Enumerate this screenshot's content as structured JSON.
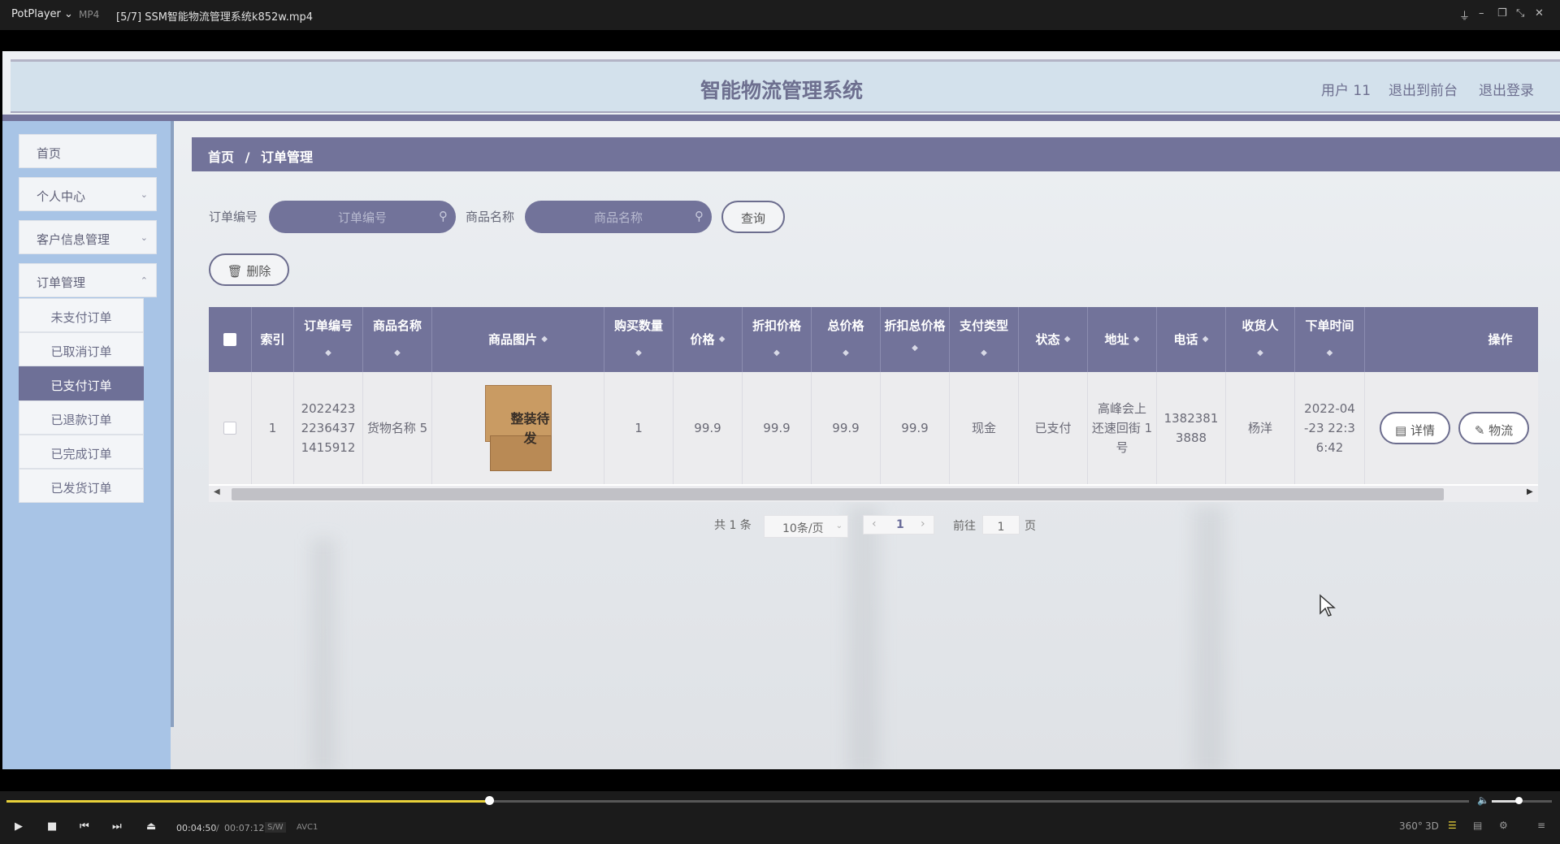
{
  "player": {
    "app": "PotPlayer ⌄",
    "format": "MP4",
    "file_title": "[5/7] SSM智能物流管理系统k852w.mp4",
    "window_buttons": [
      "⏚",
      "–",
      "❐",
      "⤡",
      "✕"
    ],
    "time_current": "00:04:50",
    "time_separator": "/",
    "time_total": "00:07:12",
    "tag_sw": "S/W",
    "tag_codec": "AVC1",
    "progress_fraction": 0.33,
    "volume_fraction": 0.45,
    "right_icons": [
      "360°",
      "3D"
    ]
  },
  "header": {
    "title": "智能物流管理系统",
    "user": "用户 11",
    "to_front": "退出到前台",
    "logout": "退出登录"
  },
  "sidebar": {
    "items": [
      {
        "label": "首页"
      },
      {
        "label": "个人中心"
      },
      {
        "label": "客户信息管理"
      },
      {
        "label": "订单管理"
      }
    ],
    "sub_items": [
      {
        "label": "未支付订单"
      },
      {
        "label": "已取消订单"
      },
      {
        "label": "已支付订单"
      },
      {
        "label": "已退款订单"
      },
      {
        "label": "已完成订单"
      },
      {
        "label": "已发货订单"
      }
    ]
  },
  "breadcrumb": {
    "home": "首页",
    "sep": "/",
    "current": "订单管理"
  },
  "search": {
    "order_no_label": "订单编号",
    "order_no_placeholder": "订单编号",
    "product_label": "商品名称",
    "product_placeholder": "商品名称",
    "query_button": "查询",
    "delete_button": "删除"
  },
  "table": {
    "headers": {
      "index": "索引",
      "order_no": "订单编号",
      "product": "商品名称",
      "image": "商品图片",
      "qty": "购买数量",
      "price": "价格",
      "disc_price": "折扣价格",
      "total": "总价格",
      "disc_total": "折扣总价格",
      "pay_type": "支付类型",
      "status": "状态",
      "address": "地址",
      "phone": "电话",
      "receiver": "收货人",
      "order_time": "下单时间",
      "actions": "操作"
    },
    "rows": [
      {
        "index": "1",
        "order_no": "2022423 2236437 1415912",
        "product": "货物名称 5",
        "image_text": "整装待发",
        "qty": "1",
        "price": "99.9",
        "disc_price": "99.9",
        "total": "99.9",
        "disc_total": "99.9",
        "pay_type": "现金",
        "status": "已支付",
        "address": "高峰会上 还速回街 1号",
        "phone": "1382381 3888",
        "receiver": "杨洋",
        "order_time": "2022-04 -23 22:3 6:42",
        "detail_button": "详情",
        "logistics_button": "物流"
      }
    ]
  },
  "pagination": {
    "total": "共 1 条",
    "page_size": "10条/页",
    "current_page": "1",
    "goto_label": "前往",
    "goto_value": "1",
    "page_unit": "页"
  }
}
